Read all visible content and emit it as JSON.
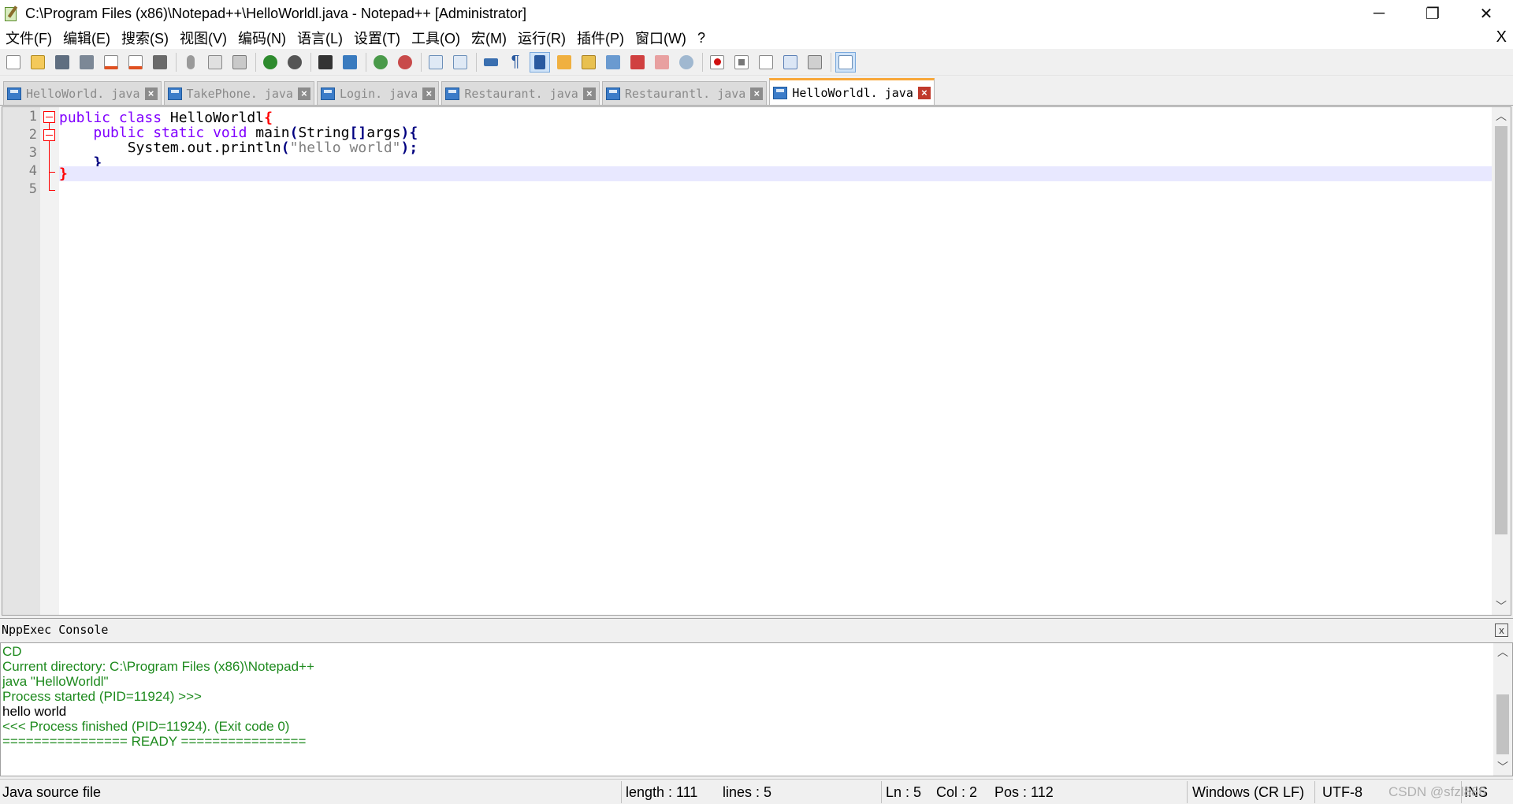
{
  "window": {
    "title": "C:\\Program Files (x86)\\Notepad++\\HelloWorldl.java - Notepad++ [Administrator]",
    "minimize": "─",
    "restore": "❐",
    "close": "✕"
  },
  "menu": {
    "items": [
      "文件(F)",
      "编辑(E)",
      "搜索(S)",
      "视图(V)",
      "编码(N)",
      "语言(L)",
      "设置(T)",
      "工具(O)",
      "宏(M)",
      "运行(R)",
      "插件(P)",
      "窗口(W)",
      "?"
    ],
    "close": "X"
  },
  "toolbar": {
    "icons": [
      "new-file-icon",
      "open-file-icon",
      "save-icon",
      "save-all-icon",
      "close-icon",
      "close-all-icon",
      "print-icon",
      "cut-icon",
      "copy-icon",
      "paste-icon",
      "undo-icon",
      "redo-icon",
      "find-icon",
      "replace-icon",
      "zoom-in-icon",
      "zoom-out-icon",
      "sync-vertical-icon",
      "sync-horizontal-icon",
      "word-wrap-icon",
      "show-all-chars-icon",
      "indent-guide-icon",
      "udl-icon",
      "doc-map-icon",
      "function-list-icon",
      "folder-workspace-icon",
      "monitor-icon",
      "record-macro-icon",
      "stop-macro-icon",
      "play-macro-icon",
      "run-macro-multiple-icon",
      "save-macro-icon",
      "panel-icon"
    ]
  },
  "tabs": [
    {
      "label": "HelloWorld. java",
      "active": false
    },
    {
      "label": "TakePhone. java",
      "active": false
    },
    {
      "label": "Login. java",
      "active": false
    },
    {
      "label": "Restaurant. java",
      "active": false
    },
    {
      "label": "Restaurantl. java",
      "active": false
    },
    {
      "label": "HelloWorldl. java",
      "active": true
    }
  ],
  "editor": {
    "line_numbers": [
      "1",
      "2",
      "3",
      "4",
      "5"
    ],
    "lines": [
      {
        "indent": "",
        "kw": "public class",
        "plain": " HelloWorldl",
        "brace": "{"
      },
      {
        "indent": "    ",
        "kw": "public static void",
        "plain": " main",
        "op1": "(",
        "plain2": "String",
        "op2": "[]",
        "plain3": "args",
        "op3": ")",
        "brace": "{"
      },
      {
        "indent": "        ",
        "plain": "System.out.println",
        "op1": "(",
        "str": "\"hello world\"",
        "op2": ");"
      },
      {
        "indent": "    ",
        "op": "}"
      },
      {
        "indent": "",
        "brace": "}"
      }
    ]
  },
  "console": {
    "title": "NppExec Console",
    "close": "x",
    "lines": [
      {
        "text": "CD",
        "color": "green"
      },
      {
        "text": "Current directory: C:\\Program Files (x86)\\Notepad++",
        "color": "green"
      },
      {
        "text": "java \"HelloWorldl\"",
        "color": "green"
      },
      {
        "text": "Process started (PID=11924) >>>",
        "color": "green"
      },
      {
        "text": "hello world",
        "color": "black"
      },
      {
        "text": "<<< Process finished (PID=11924). (Exit code 0)",
        "color": "green"
      },
      {
        "text": "================ READY ================",
        "color": "green"
      }
    ]
  },
  "statusbar": {
    "file_type": "Java source file",
    "length": "length : 111",
    "lines": "lines : 5",
    "ln": "Ln : 5",
    "col": "Col : 2",
    "pos": "Pos : 112",
    "eol": "Windows (CR LF)",
    "encoding": "UTF-8",
    "mode": "INS",
    "watermark": "CSDN @sfzl886"
  },
  "colors": {
    "keyword": "#8000ff",
    "string": "#808080",
    "operator": "#000080",
    "fold_brace": "#ff0000",
    "console_green": "#1e8a1e",
    "caret_line": "#e8e8ff",
    "active_tab_accent": "#f8a83a"
  }
}
